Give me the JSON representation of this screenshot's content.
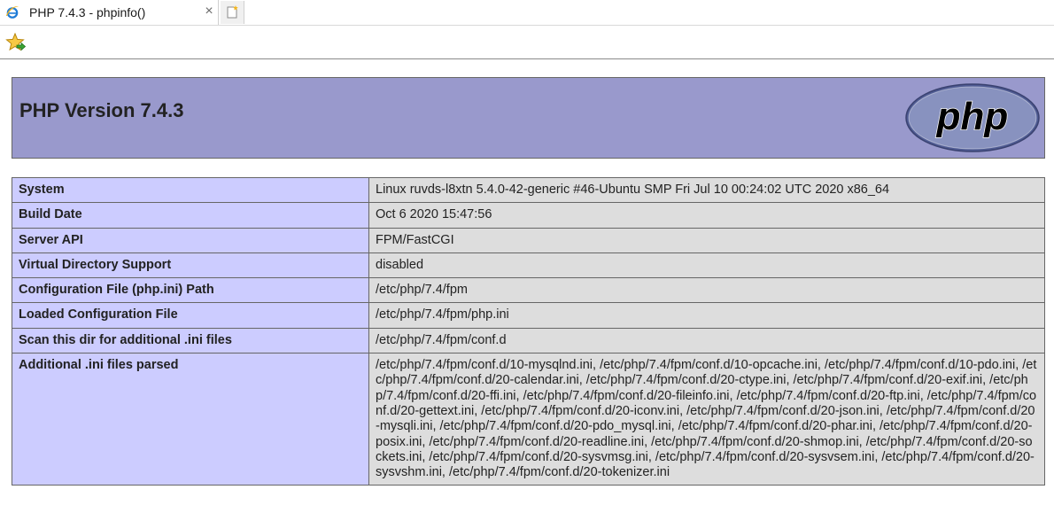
{
  "browser": {
    "tab_title": "PHP 7.4.3 - phpinfo()",
    "tab_close": "×",
    "icons": {
      "tab": "internet-explorer-icon",
      "new_tab": "new-tab-icon",
      "favorites": "add-to-favorites-icon"
    }
  },
  "page": {
    "title": "PHP Version 7.4.3",
    "logo_text": "php",
    "colors": {
      "header_bg": "#9999cc",
      "key_bg": "#ccccff",
      "value_bg": "#dddddd"
    },
    "rows": [
      {
        "key": "System",
        "value": "Linux ruvds-l8xtn 5.4.0-42-generic #46-Ubuntu SMP Fri Jul 10 00:24:02 UTC 2020 x86_64"
      },
      {
        "key": "Build Date",
        "value": "Oct 6 2020 15:47:56"
      },
      {
        "key": "Server API",
        "value": "FPM/FastCGI"
      },
      {
        "key": "Virtual Directory Support",
        "value": "disabled"
      },
      {
        "key": "Configuration File (php.ini) Path",
        "value": "/etc/php/7.4/fpm"
      },
      {
        "key": "Loaded Configuration File",
        "value": "/etc/php/7.4/fpm/php.ini"
      },
      {
        "key": "Scan this dir for additional .ini files",
        "value": "/etc/php/7.4/fpm/conf.d"
      },
      {
        "key": "Additional .ini files parsed",
        "value": "/etc/php/7.4/fpm/conf.d/10-mysqlnd.ini, /etc/php/7.4/fpm/conf.d/10-opcache.ini, /etc/php/7.4/fpm/conf.d/10-pdo.ini, /etc/php/7.4/fpm/conf.d/20-calendar.ini, /etc/php/7.4/fpm/conf.d/20-ctype.ini, /etc/php/7.4/fpm/conf.d/20-exif.ini, /etc/php/7.4/fpm/conf.d/20-ffi.ini, /etc/php/7.4/fpm/conf.d/20-fileinfo.ini, /etc/php/7.4/fpm/conf.d/20-ftp.ini, /etc/php/7.4/fpm/conf.d/20-gettext.ini, /etc/php/7.4/fpm/conf.d/20-iconv.ini, /etc/php/7.4/fpm/conf.d/20-json.ini, /etc/php/7.4/fpm/conf.d/20-mysqli.ini, /etc/php/7.4/fpm/conf.d/20-pdo_mysql.ini, /etc/php/7.4/fpm/conf.d/20-phar.ini, /etc/php/7.4/fpm/conf.d/20-posix.ini, /etc/php/7.4/fpm/conf.d/20-readline.ini, /etc/php/7.4/fpm/conf.d/20-shmop.ini, /etc/php/7.4/fpm/conf.d/20-sockets.ini, /etc/php/7.4/fpm/conf.d/20-sysvmsg.ini, /etc/php/7.4/fpm/conf.d/20-sysvsem.ini, /etc/php/7.4/fpm/conf.d/20-sysvshm.ini, /etc/php/7.4/fpm/conf.d/20-tokenizer.ini"
      }
    ]
  }
}
